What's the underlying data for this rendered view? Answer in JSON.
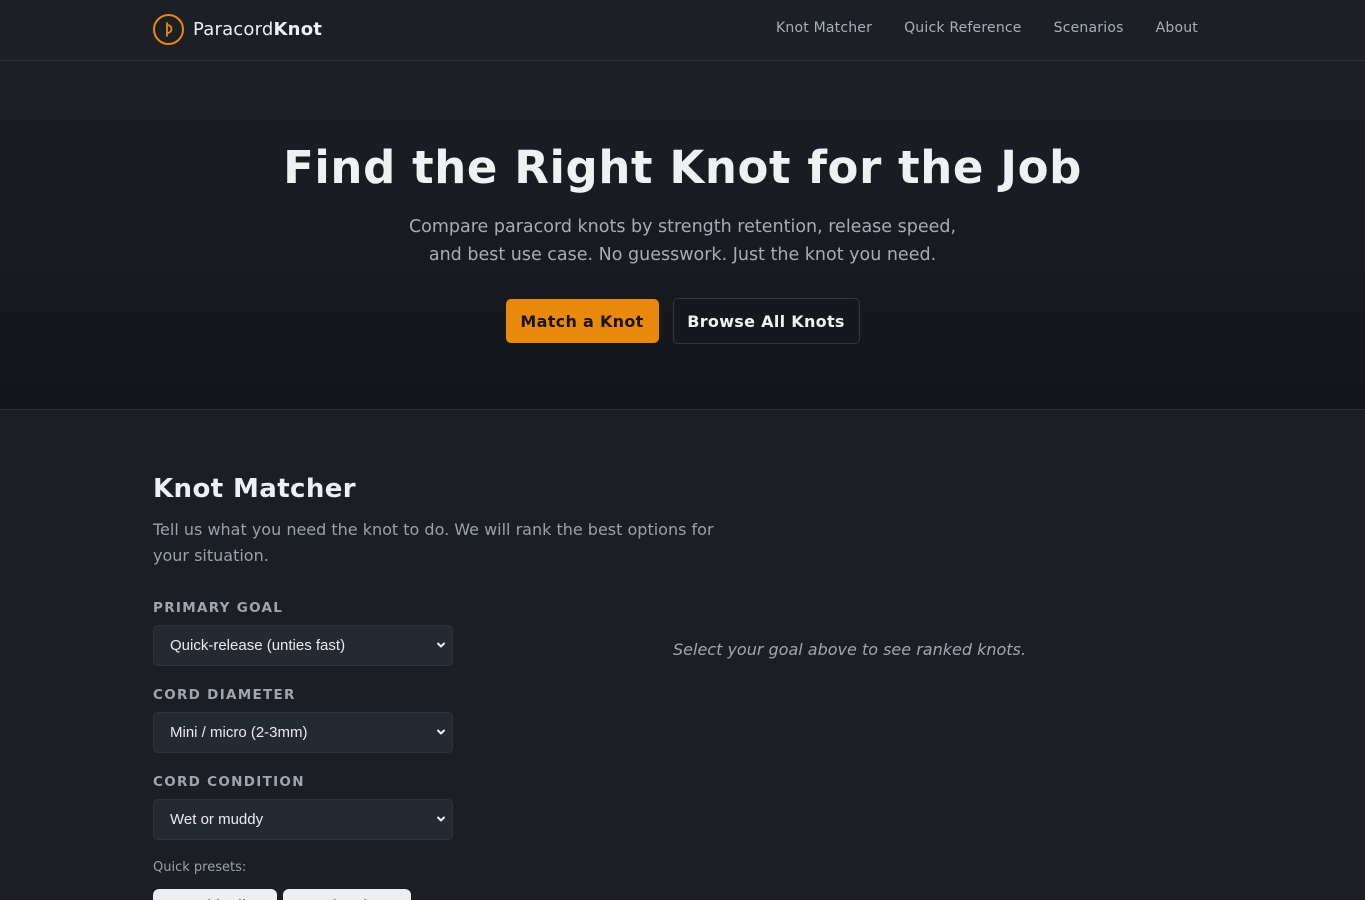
{
  "brand": {
    "name_light": "Paracord",
    "name_bold": "Knot",
    "accent": "#e8890c"
  },
  "nav": [
    {
      "label": "Knot Matcher"
    },
    {
      "label": "Quick Reference"
    },
    {
      "label": "Scenarios"
    },
    {
      "label": "About"
    }
  ],
  "hero": {
    "title": "Find the Right Knot for the Job",
    "subtitle_line1": "Compare paracord knots by strength retention, release speed,",
    "subtitle_line2": "and best use case. No guesswork. Just the knot you need.",
    "primary_button": "Match a Knot",
    "secondary_button": "Browse All Knots"
  },
  "matcher": {
    "title": "Knot Matcher",
    "intro": "Tell us what you need the knot to do. We will rank the best options for your situation.",
    "fields": {
      "goal": {
        "label": "PRIMARY GOAL",
        "value": "Quick-release (unties fast)"
      },
      "diameter": {
        "label": "CORD DIAMETER",
        "value": "Mini / micro (2-3mm)"
      },
      "condition": {
        "label": "CORD CONDITION",
        "value": "Wet or muddy"
      }
    },
    "presets_label": "Quick presets:",
    "presets": [
      "Tarp ridgeline",
      "Bear bag hang"
    ],
    "result_placeholder": "Select your goal above to see ranked knots."
  }
}
